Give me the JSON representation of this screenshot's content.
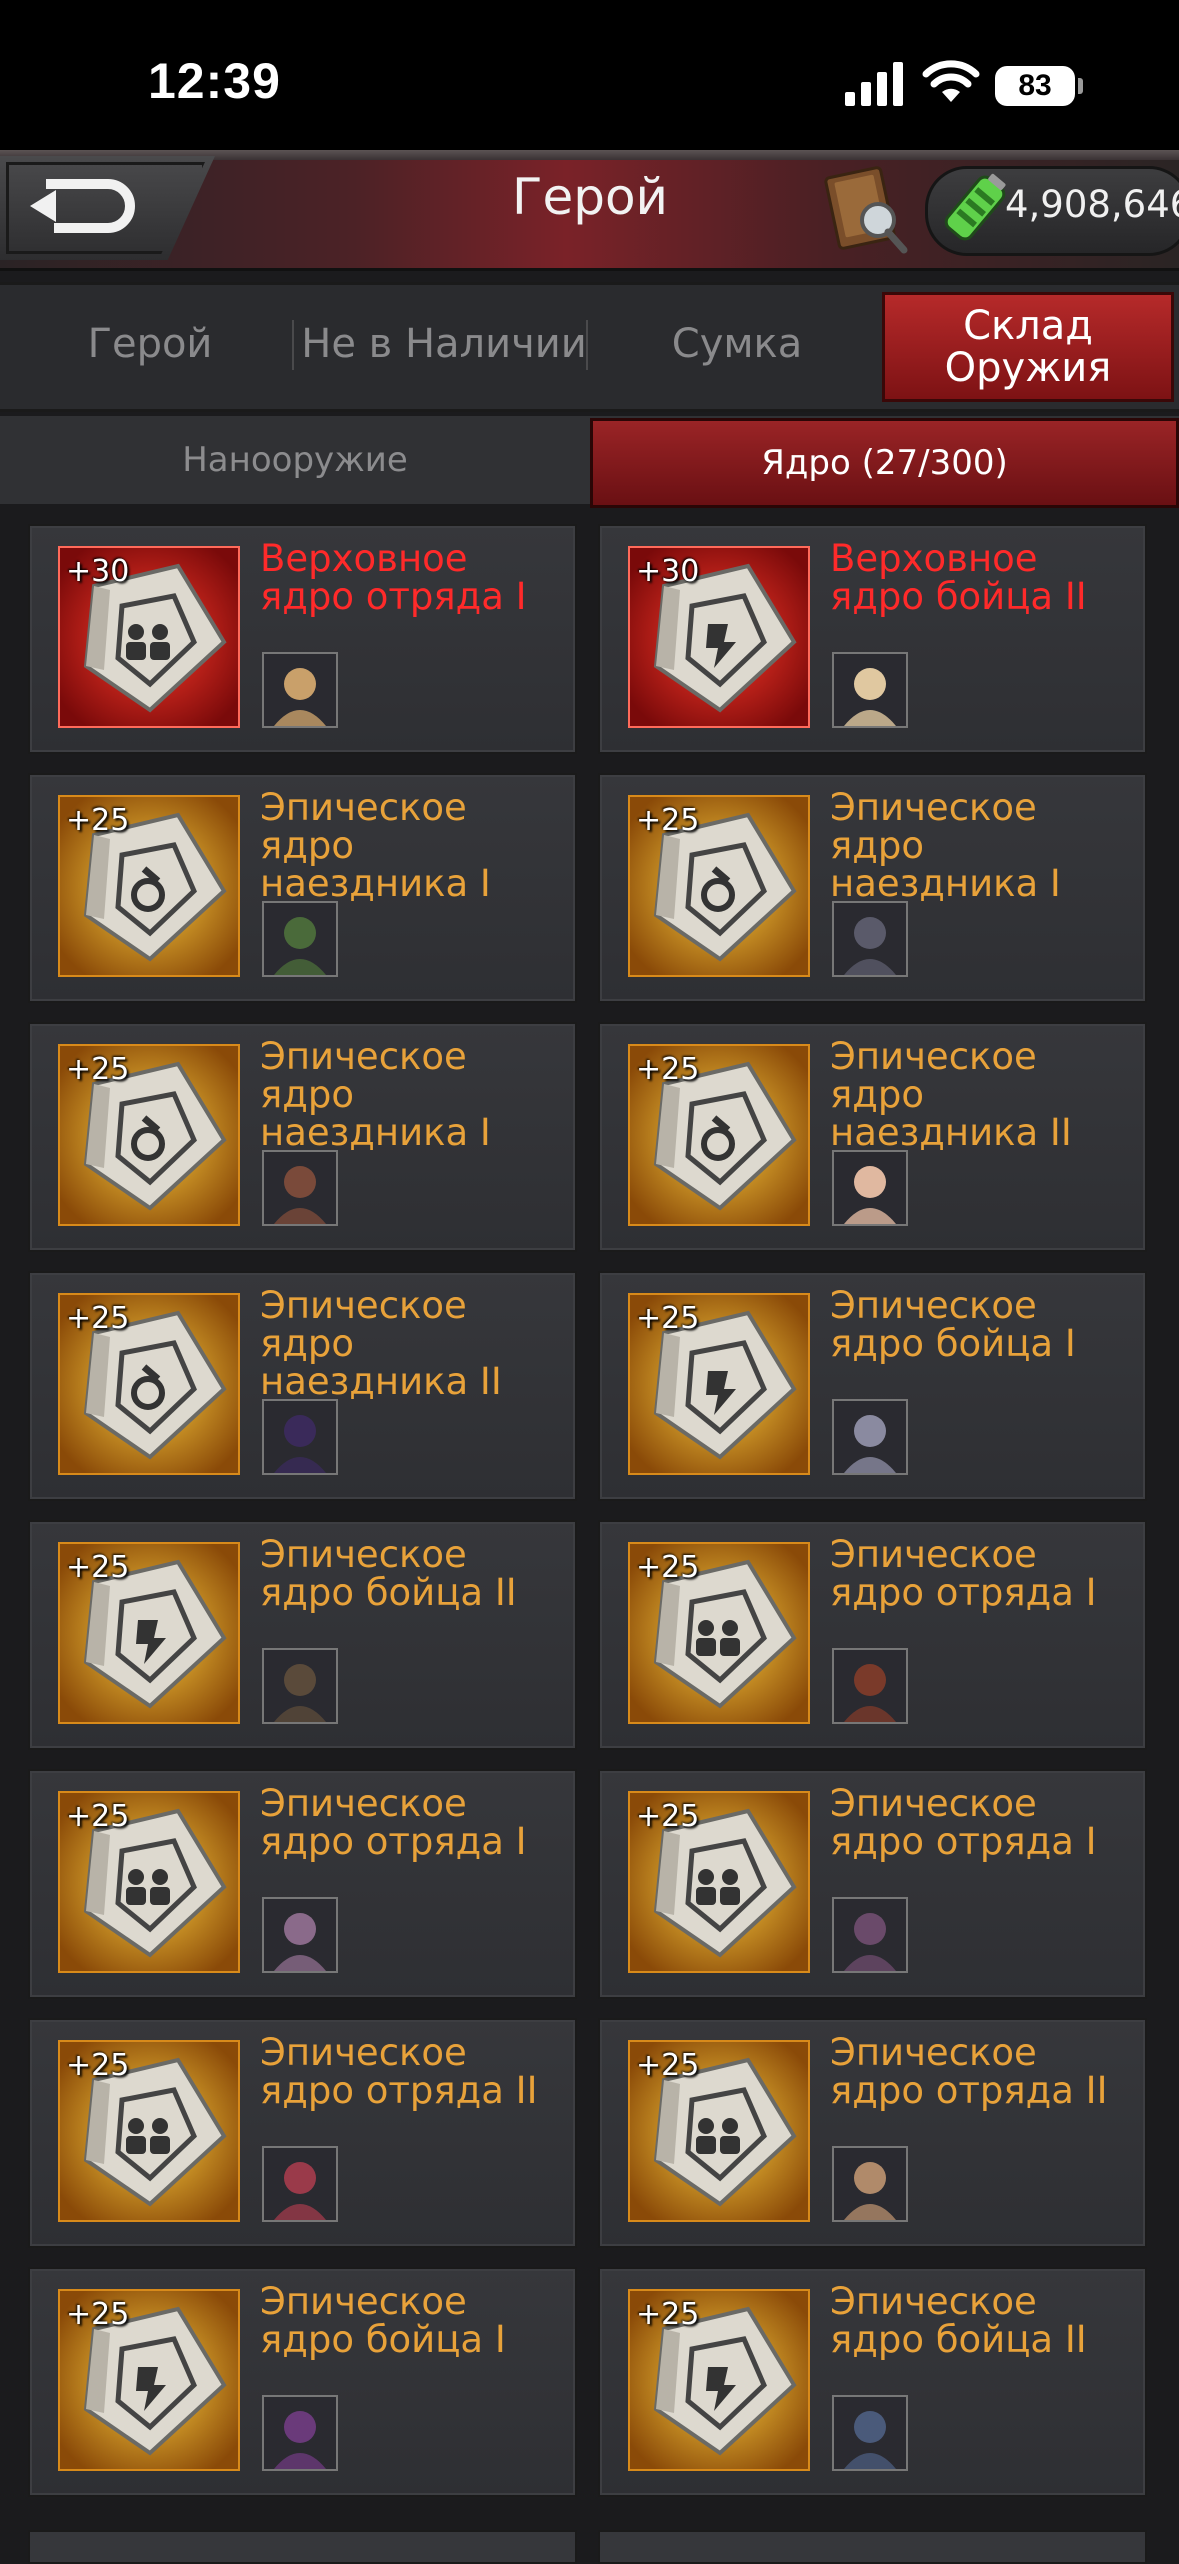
{
  "status_bar": {
    "time": "12:39",
    "battery": "83"
  },
  "header": {
    "title": "Герой",
    "currency": "4,908,646"
  },
  "main_tabs": [
    {
      "label": "Герой"
    },
    {
      "label": "Не в Наличии"
    },
    {
      "label": "Сумка"
    },
    {
      "label": "Склад\nОружия",
      "active": true
    }
  ],
  "sub_tabs": [
    {
      "label": "Нанооружие"
    },
    {
      "label": "Ядро (27/300)",
      "active": true
    }
  ],
  "colors": {
    "legendary": "#ff2a2a",
    "epic": "#e8a23a",
    "accent": "#9a2426"
  },
  "cards": [
    {
      "level": "+30",
      "name": "Верховное ядро отряда I",
      "rarity": "legendary",
      "icon": "squad-core-icon"
    },
    {
      "level": "+30",
      "name": "Верховное ядро бойца II",
      "rarity": "legendary",
      "icon": "fighter-core-icon"
    },
    {
      "level": "+25",
      "name": "Эпическое ядро наездника I",
      "rarity": "epic",
      "icon": "rider-core-icon"
    },
    {
      "level": "+25",
      "name": "Эпическое ядро наездника I",
      "rarity": "epic",
      "icon": "rider-core-icon"
    },
    {
      "level": "+25",
      "name": "Эпическое ядро наездника I",
      "rarity": "epic",
      "icon": "rider-core-icon"
    },
    {
      "level": "+25",
      "name": "Эпическое ядро наездника II",
      "rarity": "epic",
      "icon": "rider-core-icon"
    },
    {
      "level": "+25",
      "name": "Эпическое ядро наездника II",
      "rarity": "epic",
      "icon": "rider-core-icon"
    },
    {
      "level": "+25",
      "name": "Эпическое ядро бойца I",
      "rarity": "epic",
      "icon": "fighter-core-icon"
    },
    {
      "level": "+25",
      "name": "Эпическое ядро бойца II",
      "rarity": "epic",
      "icon": "fighter-core-icon"
    },
    {
      "level": "+25",
      "name": "Эпическое ядро отряда I",
      "rarity": "epic",
      "icon": "squad-core-icon"
    },
    {
      "level": "+25",
      "name": "Эпическое ядро отряда I",
      "rarity": "epic",
      "icon": "squad-core-icon"
    },
    {
      "level": "+25",
      "name": "Эпическое ядро отряда I",
      "rarity": "epic",
      "icon": "squad-core-icon"
    },
    {
      "level": "+25",
      "name": "Эпическое ядро отряда II",
      "rarity": "epic",
      "icon": "squad-core-icon"
    },
    {
      "level": "+25",
      "name": "Эпическое ядро отряда II",
      "rarity": "epic",
      "icon": "squad-core-icon"
    },
    {
      "level": "+25",
      "name": "Эпическое ядро бойца I",
      "rarity": "epic",
      "icon": "fighter-core-icon"
    },
    {
      "level": "+25",
      "name": "Эпическое ядро бойца II",
      "rarity": "epic",
      "icon": "fighter-core-icon"
    }
  ]
}
